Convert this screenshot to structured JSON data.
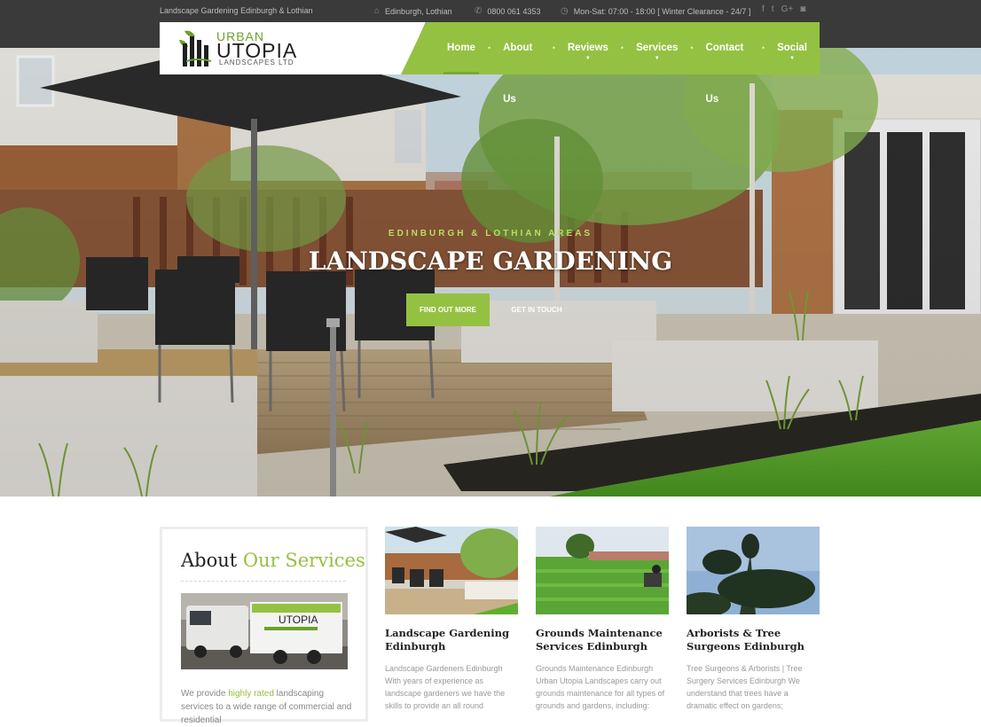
{
  "topbar": {
    "tagline": "Landscape Gardening Edinburgh & Lothian",
    "location": "Edinburgh, Lothian",
    "phone": "0800 061 4353",
    "hours": "Mon-Sat: 07:00 - 18:00 [ Winter Clearance - 24/7 ]",
    "social_icons": [
      "facebook-icon",
      "twitter-icon",
      "google-plus-icon",
      "instagram-icon"
    ]
  },
  "logo": {
    "line1": "URBAN",
    "line2": "UTOPIA",
    "line3": "LANDSCAPES LTD"
  },
  "nav": {
    "items": [
      {
        "label": "Home",
        "active": true,
        "has_dropdown": false
      },
      {
        "label": "About Us",
        "active": false,
        "has_dropdown": false
      },
      {
        "label": "Reviews",
        "active": false,
        "has_dropdown": true
      },
      {
        "label": "Services",
        "active": false,
        "has_dropdown": true
      },
      {
        "label": "Contact Us",
        "active": false,
        "has_dropdown": false
      },
      {
        "label": "Social",
        "active": false,
        "has_dropdown": true
      }
    ]
  },
  "hero": {
    "subtitle": "EDINBURGH & LOTHIAN AREAS",
    "title": "LANDSCAPE GARDENING",
    "primary_button": "FIND OUT MORE",
    "secondary_button": "GET IN TOUCH"
  },
  "about": {
    "title_plain": "About",
    "title_accent": "Our Services",
    "text_before": "We provide ",
    "text_highlight": "highly rated",
    "text_after": " landscaping services to a wide range of commercial and residential"
  },
  "services": [
    {
      "title": "Landscape Gardening Edinburgh",
      "text": "Landscape Gardeners Edinburgh With years of experience as landscape gardeners we have the skills to provide an all round"
    },
    {
      "title": "Grounds Maintenance Services Edinburgh",
      "text": "Grounds Maintenance Edinburgh Urban Utopia Landscapes carry out grounds maintenance for all types of grounds and gardens, including:"
    },
    {
      "title": "Arborists & Tree Surgeons Edinburgh",
      "text": "Tree Surgeons & Arborists | Tree Surgery Services Edinburgh We understand that trees have a dramatic effect on gardens;"
    }
  ],
  "colors": {
    "brand_green": "#95c142",
    "topbar_bg": "#3a3a3a"
  }
}
